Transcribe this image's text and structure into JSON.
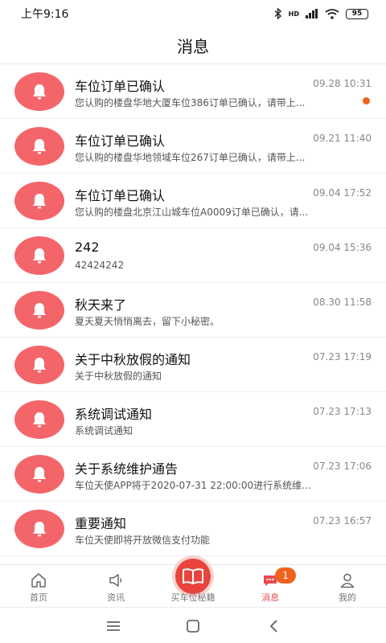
{
  "status": {
    "time": "上午9:16",
    "signal": "HD",
    "battery": "95"
  },
  "header": {
    "title": "消息"
  },
  "messages": [
    {
      "title": "车位订单已确认",
      "time": "09.28 10:31",
      "preview": "您认购的楼盘华地大厦车位386订单已确认，请带上...",
      "unread": true
    },
    {
      "title": "车位订单已确认",
      "time": "09.21 11:40",
      "preview": "您认购的楼盘华地领域车位267订单已确认，请带上...",
      "unread": false
    },
    {
      "title": "车位订单已确认",
      "time": "09.04 17:52",
      "preview": "您认购的楼盘北京江山城车位A0009订单已确认，请...",
      "unread": false
    },
    {
      "title": "242",
      "time": "09.04 15:36",
      "preview": "42424242",
      "unread": false
    },
    {
      "title": "秋天来了",
      "time": "08.30 11:58",
      "preview": "夏天夏天悄悄离去，留下小秘密。",
      "unread": false
    },
    {
      "title": "关于中秋放假的通知",
      "time": "07.23 17:19",
      "preview": "关于中秋放假的通知",
      "unread": false
    },
    {
      "title": "系统调试通知",
      "time": "07.23 17:13",
      "preview": "系统调试通知",
      "unread": false
    },
    {
      "title": "关于系统维护通告",
      "time": "07.23 17:06",
      "preview": "车位天使APP将于2020-07-31 22:00:00进行系统维...",
      "unread": false
    },
    {
      "title": "重要通知",
      "time": "07.23 16:57",
      "preview": "车位天使即将开放微信支付功能",
      "unread": false
    }
  ],
  "tabs": {
    "home": "首页",
    "news": "资讯",
    "center": "买车位秘籍",
    "messages": "消息",
    "messages_badge": "1",
    "mine": "我的",
    "active": "messages"
  },
  "colors": {
    "accent": "#e84a4f",
    "avatar": "#f4656a",
    "badge": "#f0631e"
  }
}
